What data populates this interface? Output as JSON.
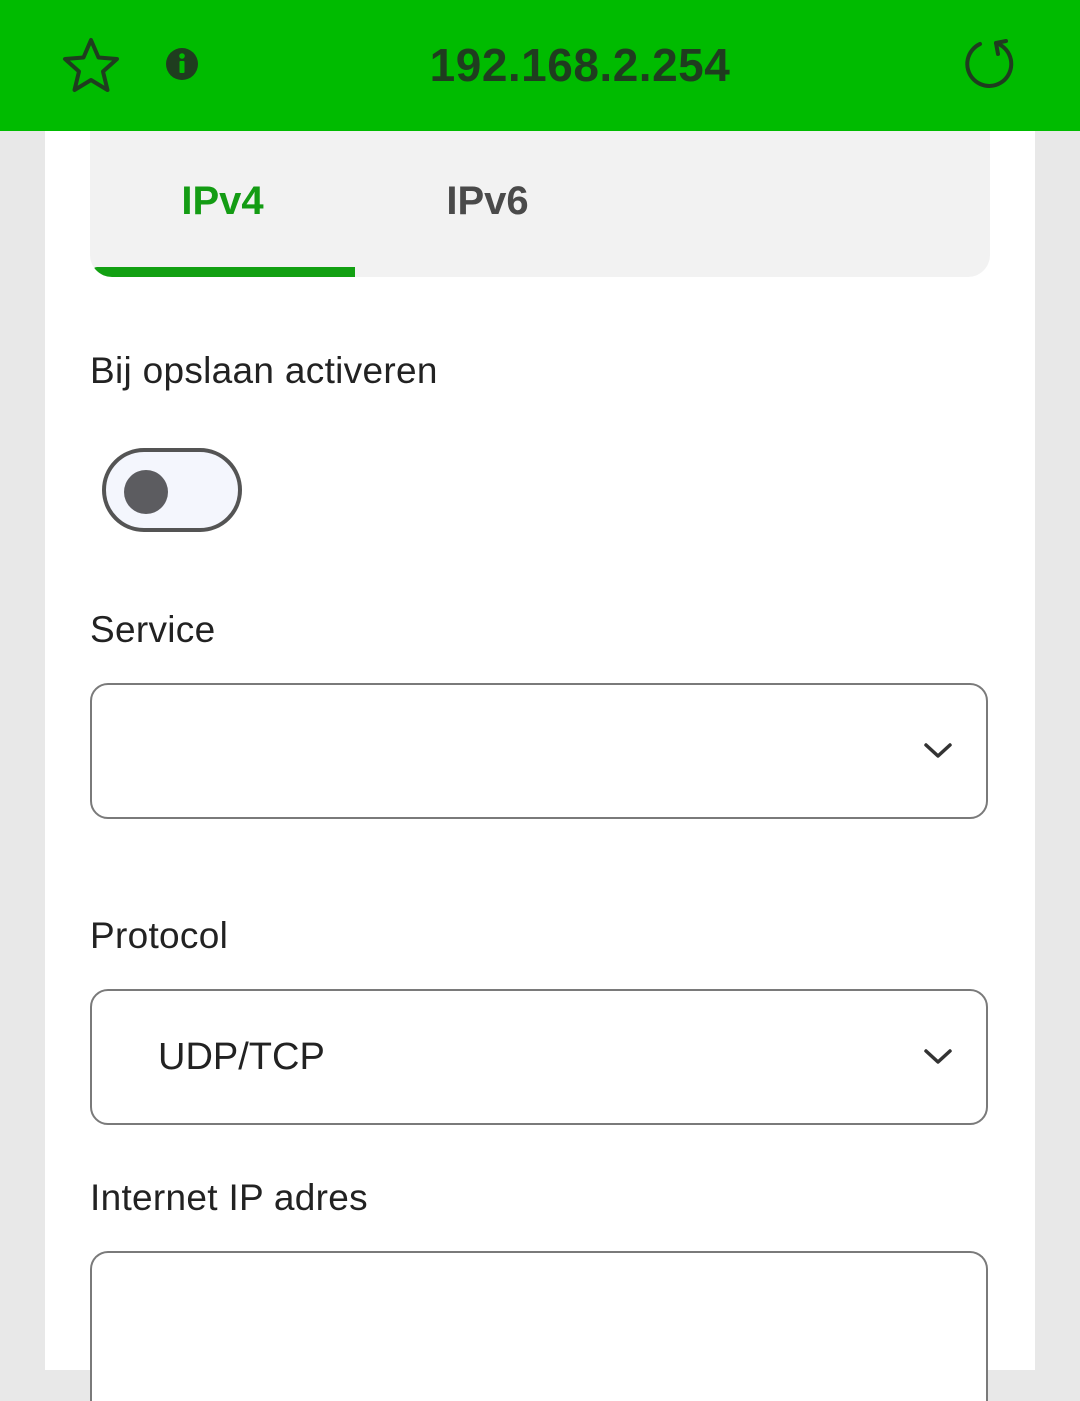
{
  "browser": {
    "url": "192.168.2.254",
    "icons": {
      "bookmark": "star-icon",
      "site_info": "info-icon",
      "reload": "reload-icon"
    },
    "bar_color": "#00bb00"
  },
  "tabs": [
    {
      "label": "IPv4",
      "active": true
    },
    {
      "label": "IPv6",
      "active": false
    }
  ],
  "form": {
    "activate": {
      "label": "Bij opslaan activeren",
      "enabled": false
    },
    "service": {
      "label": "Service",
      "value": ""
    },
    "protocol": {
      "label": "Protocol",
      "value": "UDP/TCP"
    },
    "internet_ip": {
      "label": "Internet IP adres",
      "value": ""
    }
  },
  "colors": {
    "accent": "#12a012",
    "active_tab_text": "#149c14",
    "inactive_tab_text": "#4a4a4a"
  }
}
